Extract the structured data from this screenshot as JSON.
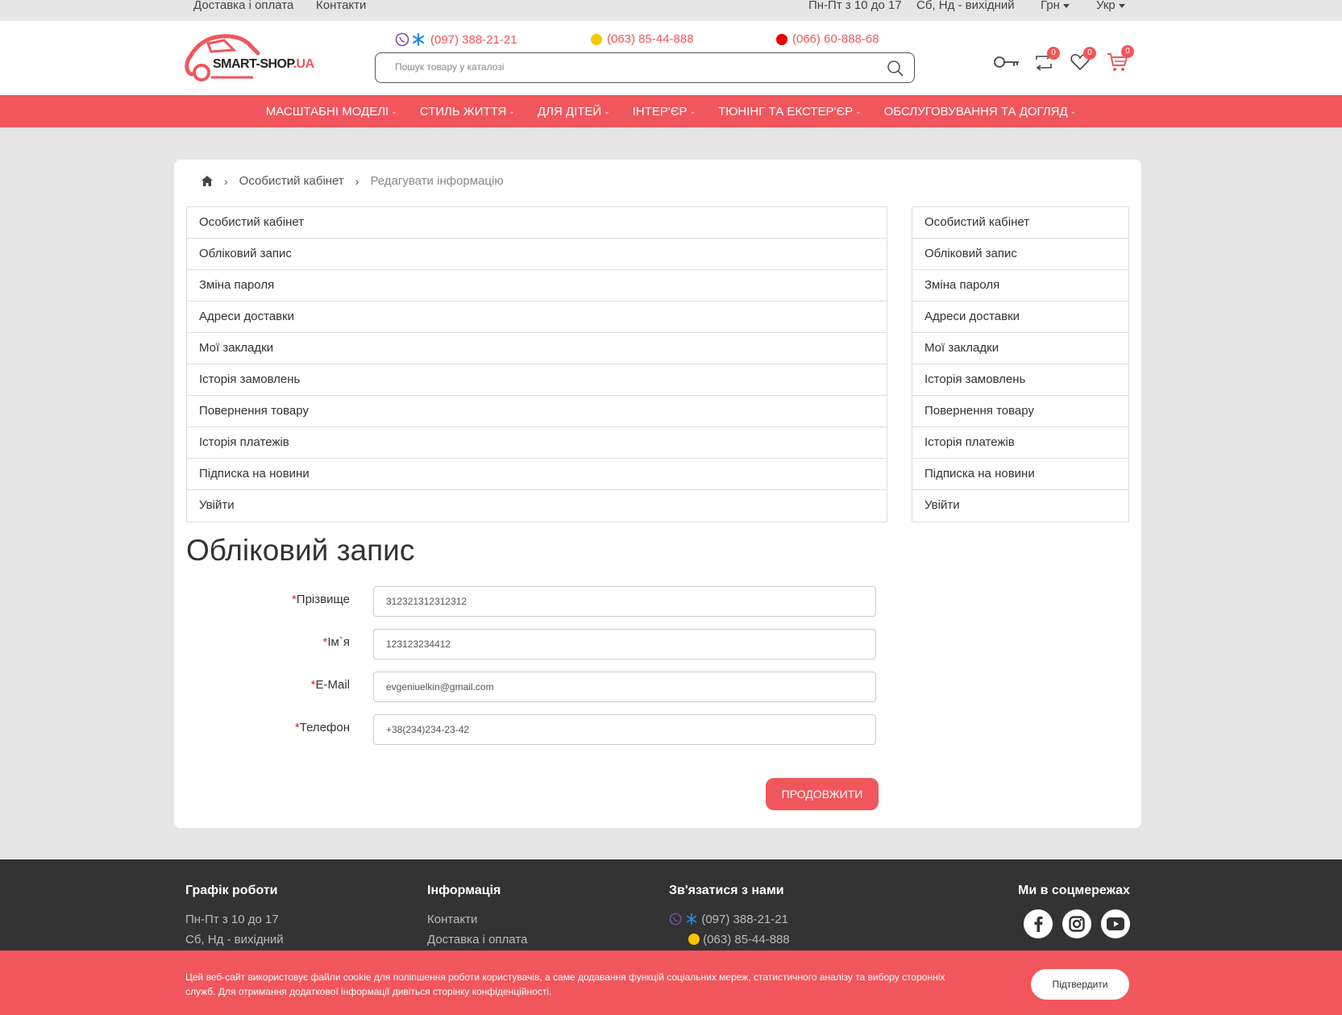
{
  "topbar": {
    "links": [
      "Доставка і оплата",
      "Контакти"
    ],
    "hours_weekdays": "Пн-Пт з 10 до 17",
    "hours_weekend": "Сб, Нд - вихідний",
    "currency": "Грн",
    "language": "Укр"
  },
  "header": {
    "logo_main": "SMART-SHOP",
    "logo_suffix": ".UA",
    "phones": [
      "(097) 388-21-21",
      "(063) 85-44-888",
      "(066) 60-888-68"
    ],
    "search_placeholder": "Пошук товару у каталозі",
    "compare_count": "0",
    "wishlist_count": "0",
    "cart_count": "0"
  },
  "nav": {
    "items": [
      "МАСШТАБНІ МОДЕЛІ",
      "СТИЛЬ ЖИТТЯ",
      "ДЛЯ ДІТЕЙ",
      "ІНТЕР'ЄР",
      "ТЮНІНГ ТА ЕКСТЕР'ЄР",
      "ОБСЛУГОВУВАННЯ ТА ДОГЛЯД"
    ]
  },
  "breadcrumb": {
    "items": [
      "Особистий кабінет",
      "Редагувати інформацію"
    ]
  },
  "account_menu": [
    "Особистий кабінет",
    "Обліковий запис",
    "Зміна пароля",
    "Адреси доставки",
    "Мої закладки",
    "Історія замовлень",
    "Повернення товару",
    "Історія платежів",
    "Підписка на новини",
    "Увійти"
  ],
  "page_title": "Обліковий запис",
  "form": {
    "fields": [
      {
        "label": "Прізвище",
        "value": "312321312312312"
      },
      {
        "label": "Ім`я",
        "value": "123123234412"
      },
      {
        "label": "E-Mail",
        "value": "evgeniuelkin@gmail.com"
      },
      {
        "label": "Телефон",
        "value": "+38(234)234-23-42"
      }
    ],
    "required_mark": "*",
    "submit": "ПРОДОВЖИТИ"
  },
  "footer": {
    "schedule_title": "Графік роботи",
    "schedule": [
      "Пн-Пт з 10 до 17",
      "Сб, Нд - вихідний"
    ],
    "info_title": "Інформація",
    "info": [
      "Контакти",
      "Доставка і оплата"
    ],
    "contact_title": "Зв'язатися з нами",
    "contact": [
      "(097) 388-21-21",
      "(063) 85-44-888"
    ],
    "social_title": "Ми в соцмережах"
  },
  "cookie": {
    "text": "Цей веб-сайт використовує файли cookie для поліпшення роботи користувачів, а саме додавання функцій соціальних мереж, статистичного аналізу та вибору сторонніх служб. Для отримання додаткової інформації дивіться сторінку конфіденційності.",
    "confirm": "Підтвердити"
  },
  "colors": {
    "accent": "#f0565c",
    "footer_bg": "#333333",
    "page_bg": "#e6e6e6"
  }
}
